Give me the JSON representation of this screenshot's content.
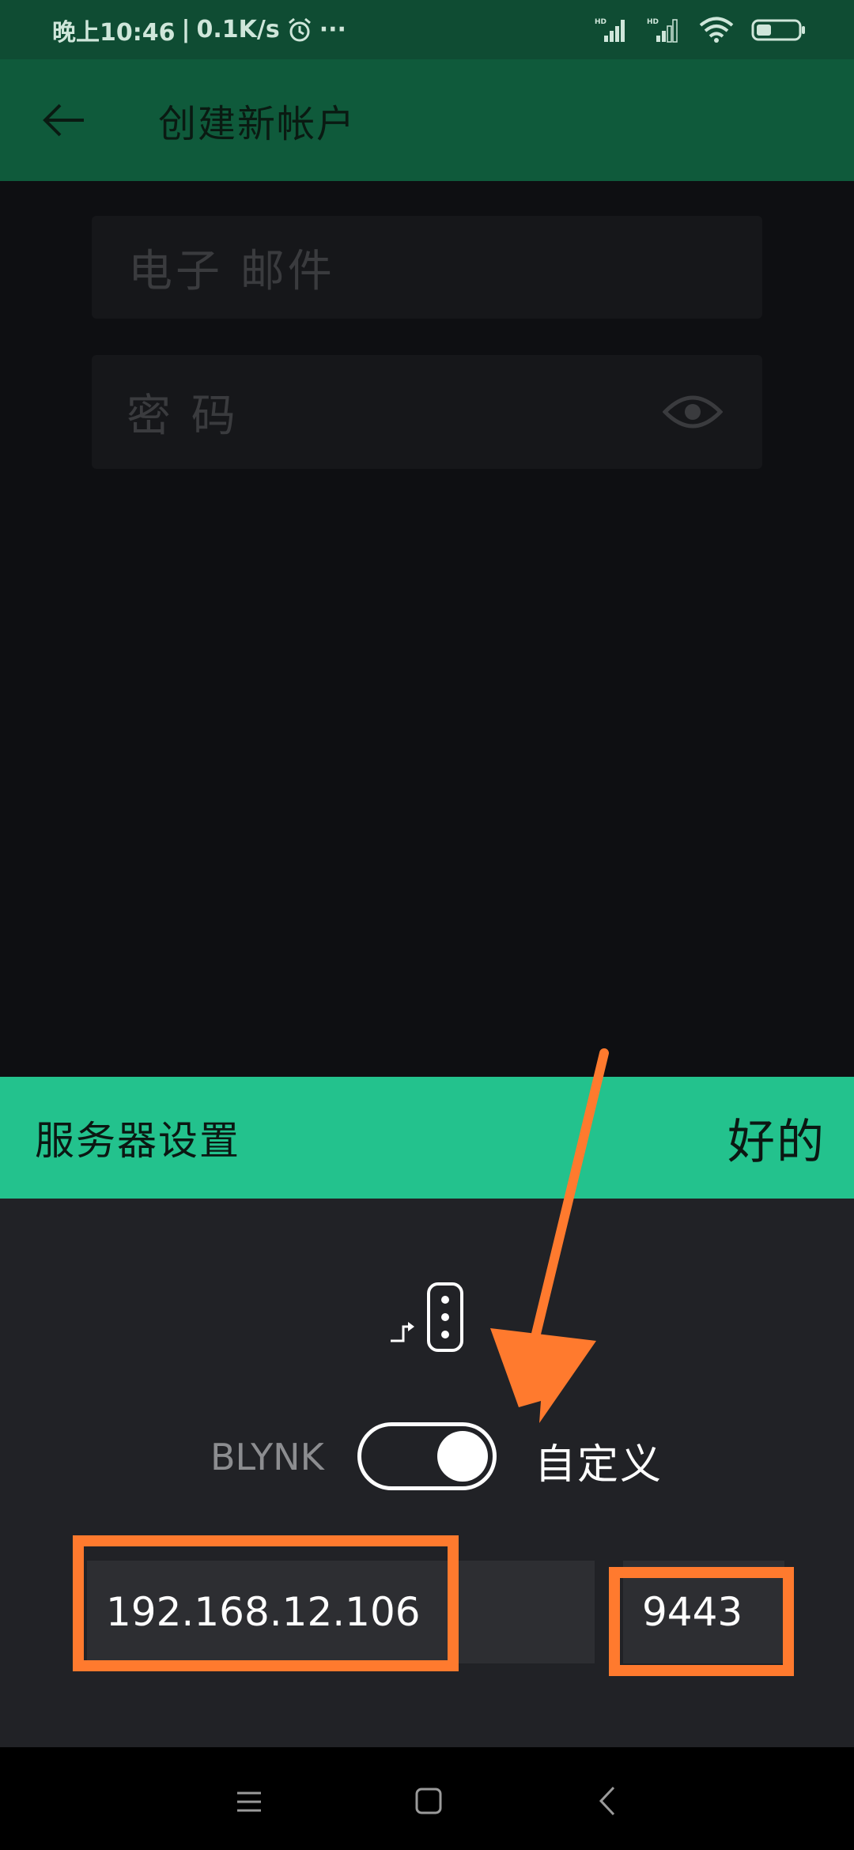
{
  "status_bar": {
    "time": "晚上10:46",
    "speed": "0.1K/s",
    "more": "···",
    "hd1": "HD",
    "hd2": "HD"
  },
  "app_bar": {
    "title": "创建新帐户"
  },
  "form": {
    "email_placeholder": "电子 邮件",
    "password_placeholder": "密 码"
  },
  "server_sheet": {
    "title": "服务器设置",
    "ok_label": "好的",
    "toggle_left_label": "BLYNK",
    "toggle_right_label": "自定义",
    "toggle_on": true,
    "host_value": "192.168.12.106",
    "port_value": "9443"
  },
  "colors": {
    "status_bar": "#0f4c33",
    "app_bar": "#0f5a3b",
    "sheet_header": "#23c28d",
    "highlight": "#ff7a2e"
  },
  "icons": {
    "back": "arrow-left-icon",
    "eye": "eye-icon",
    "server": "server-icon",
    "alarm": "alarm-clock-icon",
    "signal": "signal-icon",
    "wifi": "wifi-icon",
    "battery": "battery-icon"
  }
}
